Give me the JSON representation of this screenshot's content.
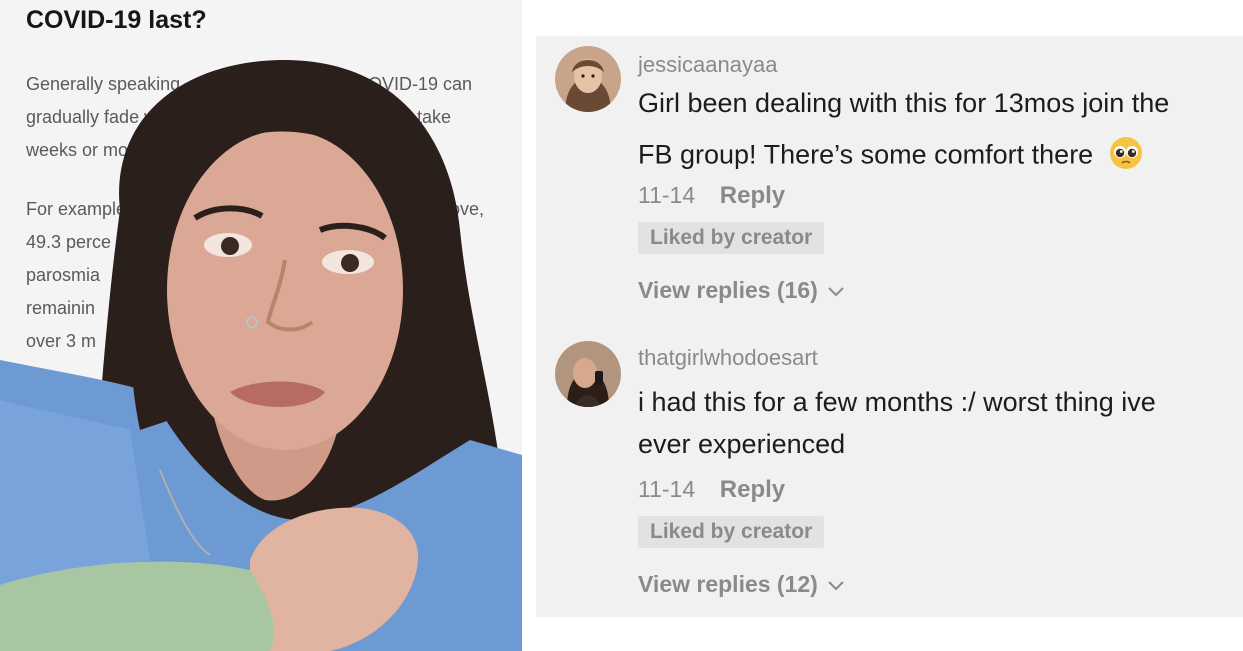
{
  "article": {
    "heading": "COVID-19 last?",
    "lines": [
      "Generally speaking, pa",
      "COVID-19 can",
      "gradually fade with",
      "y take",
      "weeks or month",
      "For example",
      "bove,",
      "49.3 perce",
      "parosmia",
      "remainin",
      "over 3 m"
    ]
  },
  "comments": [
    {
      "username": "jessicaanayaa",
      "text_line1": "Girl been dealing with this for 13mos join the",
      "text_line2": "FB group! There’s some comfort there",
      "emoji": "pleading-face",
      "date": "11-14",
      "reply_label": "Reply",
      "badge": "Liked by creator",
      "view_replies": "View replies (16)"
    },
    {
      "username": "thatgirlwhodoesart",
      "text_line1": "i had this for a few months :/ worst thing ive",
      "text_line2": "ever experienced",
      "date": "11-14",
      "reply_label": "Reply",
      "badge": "Liked by creator",
      "view_replies": "View replies (12)"
    }
  ],
  "colors": {
    "comment_text": "#1c1c1c",
    "meta_gray": "#8a8a8a",
    "badge_bg": "#e2e2e2",
    "panel_bg": "#f1f1f1"
  }
}
